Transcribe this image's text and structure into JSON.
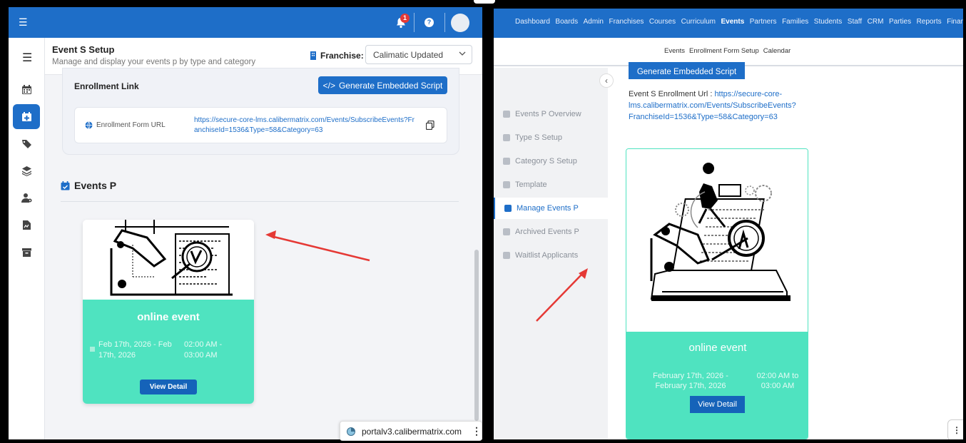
{
  "left": {
    "notification_count": "1",
    "page_title": "Event S Setup",
    "page_subtitle": "Manage and display your events p by type and category",
    "franchise_label": "Franchise:",
    "franchise_value": "Calimatic Updated",
    "enrollment_title": "Enrollment Link",
    "generate_button": "Generate Embedded Script",
    "url_label": "Enrollment Form URL",
    "url_value": "https://secure-core-lms.calibermatrix.com/Events/SubscribeEvents?FranchiseId=1536&Type=58&Category=63",
    "events_title": "Events P",
    "card": {
      "name": "online event",
      "date": "Feb 17th, 2026 - Feb 17th, 2026",
      "time": "02:00 AM - 03:00 AM",
      "button": "View Detail"
    },
    "sidebar_icons": [
      "calendar-icon",
      "calendar-plus-icon",
      "tags-icon",
      "layers-icon",
      "user-settings-icon",
      "file-icon",
      "archive-icon"
    ]
  },
  "tooltip": {
    "text": "portalv3.calibermatrix.com"
  },
  "right": {
    "nav": [
      "Dashboard",
      "Boards",
      "Admin",
      "Franchises",
      "Courses",
      "Curriculum",
      "Events",
      "Partners",
      "Families",
      "Students",
      "Staff",
      "CRM",
      "Parties",
      "Reports",
      "Financial"
    ],
    "nav_active": "Events",
    "subnav": [
      "Events",
      "Enrollment Form Setup",
      "Calendar"
    ],
    "subnav_active": "Events",
    "side": [
      "Events P Overview",
      "Type S Setup",
      "Category S Setup",
      "Template",
      "Manage Events P",
      "Archived Events P",
      "Waitlist Applicants"
    ],
    "side_active": "Manage Events P",
    "generate_button": "Generate Embedded Script",
    "url_prefix": "Event S Enrollment Url : ",
    "url_value": "https://secure-core-lms.calibermatrix.com/Events/SubscribeEvents?FranchiseId=1536&Type=58&Category=63",
    "card": {
      "name": "online event",
      "date": "February 17th, 2026 - February 17th, 2026",
      "time": "02:00 AM to 03:00 AM",
      "button": "View Detail"
    }
  },
  "colors": {
    "brand": "#1e6ec8",
    "card_teal": "#4fe3c0",
    "annotation_arrow": "#e53935"
  }
}
